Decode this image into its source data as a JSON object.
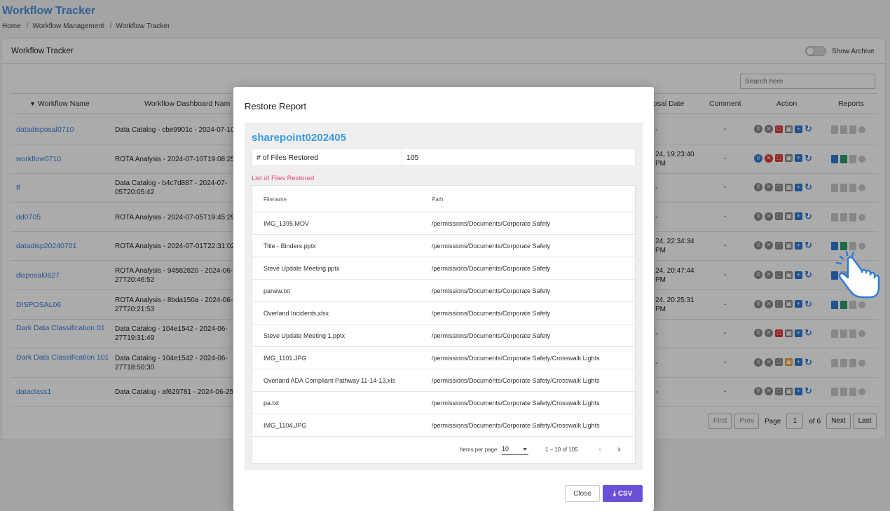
{
  "page": {
    "title": "Workflow Tracker",
    "breadcrumb": [
      "Home",
      "Workflow Management",
      "Workflow Tracker"
    ]
  },
  "card": {
    "title": "Workflow Tracker",
    "archive_label": "Show Archive",
    "search_placeholder": "Search here"
  },
  "table": {
    "headers": {
      "name": "Workflow Name",
      "dashboard": "Workflow Dashboard Nam",
      "date": "osal Date",
      "comment": "Comment",
      "action": "Action",
      "reports": "Reports"
    },
    "rows": [
      {
        "name": "datadisposal0710",
        "dashboard": "Data Catalog - cbe9901c - 2024-07-10",
        "date": "-",
        "comment": "-"
      },
      {
        "name": "workflow0710",
        "dashboard": "ROTA Analysis - 2024-07-10T19:08:25",
        "date": "24, 19:23:40 PM",
        "comment": "-"
      },
      {
        "name": "ff",
        "dashboard": "Data Catalog - b4c7d887 - 2024-07-05T20:05:42",
        "date": "-",
        "comment": "-"
      },
      {
        "name": "dd0705",
        "dashboard": "ROTA Analysis - 2024-07-05T19:45:29",
        "date": "-",
        "comment": "-"
      },
      {
        "name": "datadisp20240701",
        "dashboard": "ROTA Analysis - 2024-07-01T22:31:02",
        "date": "24, 22:34:34 PM",
        "comment": "-"
      },
      {
        "name": "disposal0627",
        "dashboard": "ROTA Analysis - 94582820 - 2024-06-27T20:46:52",
        "date": "24, 20:47:44 PM",
        "comment": "-"
      },
      {
        "name": "DISPOSAL06",
        "dashboard": "ROTA Analysis - 8bda150a - 2024-06-27T20:21:53",
        "date": "24, 20:25:31 PM",
        "comment": "-"
      },
      {
        "name": "Dark Data Classification 01",
        "dashboard": "Data Catalog - 104e1542 - 2024-06-27T19:31:49",
        "date": "-",
        "comment": "-"
      },
      {
        "name": "Dark Data Classification 101",
        "dashboard": "Data Catalog - 104e1542 - 2024-06-27T18:50:30",
        "date": "-",
        "comment": "-"
      },
      {
        "name": "dataclass1",
        "dashboard": "Data Catalog - af629781 - 2024-06-25",
        "date": "-",
        "comment": "-"
      }
    ]
  },
  "pager": {
    "first": "First",
    "prev": "Prev",
    "page_label": "Page",
    "page": "1",
    "of": "of 6",
    "next": "Next",
    "last": "Last"
  },
  "modal": {
    "title": "Restore Report",
    "report_name": "sharepoint0202405",
    "files_restored_label": "# of Files Restored",
    "files_restored_value": "105",
    "list_label": "List of Files Restored",
    "columns": {
      "filename": "Filename",
      "path": "Path"
    },
    "files": [
      {
        "filename": "IMG_1395.MOV",
        "path": "/permissions/Documents/Corporate Safety"
      },
      {
        "filename": "Title - Binders.pptx",
        "path": "/permissions/Documents/Corporate Safety"
      },
      {
        "filename": "Steve Update Meeting.pptx",
        "path": "/permissions/Documents/Corporate Safety"
      },
      {
        "filename": "panew.txt",
        "path": "/permissions/Documents/Corporate Safety"
      },
      {
        "filename": "Overland Incidents.xlsx",
        "path": "/permissions/Documents/Corporate Safety"
      },
      {
        "filename": "Steve Update Meeting 1.pptx",
        "path": "/permissions/Documents/Corporate Safety"
      },
      {
        "filename": "IMG_1101.JPG",
        "path": "/permissions/Documents/Corporate Safety/Crosswalk Lights"
      },
      {
        "filename": "Overland ADA Compliant Pathway 11-14-13.xls",
        "path": "/permissions/Documents/Corporate Safety/Crosswalk Lights"
      },
      {
        "filename": "pa.txt",
        "path": "/permissions/Documents/Corporate Safety/Crosswalk Lights"
      },
      {
        "filename": "IMG_1104.JPG",
        "path": "/permissions/Documents/Corporate Safety/Crosswalk Lights"
      }
    ],
    "pager": {
      "items_label": "Items per page:",
      "items_value": "10",
      "range": "1 – 10 of 105"
    },
    "close_label": "Close",
    "csv_label": "CSV"
  },
  "colors": {
    "accent": "#3b7dd8",
    "primary_button": "#6a4fd8",
    "list_label": "#e0457b"
  }
}
